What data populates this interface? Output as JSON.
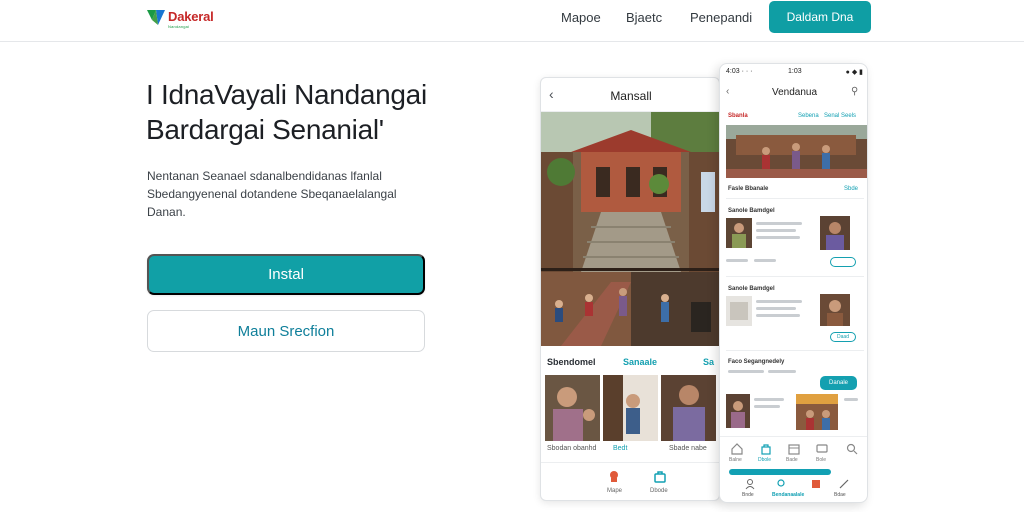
{
  "header": {
    "logo_text": "Dakeral",
    "logo_sub": "Nandangai",
    "nav": [
      "Mapoe",
      "Bjaetc",
      "Penepandi"
    ],
    "cta_label": "Daldam Dna"
  },
  "hero": {
    "title_lines": [
      "I IdnaVayali Nandangai",
      "Bardargai Senanial'"
    ],
    "desc_lines": [
      "Nentanan Seanael sdanalbendidanas lfanlal",
      "Sbedangyenenal dotandene Sbeqanaelalangal",
      "Danan."
    ],
    "primary_button": "Instal",
    "secondary_button": "Maun Srecfion"
  },
  "phone_back": {
    "title": "Mansall",
    "section_title": "Sbendomel",
    "section_link": "Sanaale",
    "section_link2": "Sa",
    "thumb_labels": [
      "Sbodan obanhd",
      "Bedt",
      "Sbade nabe"
    ],
    "tabs": [
      "Mape",
      "Dbode"
    ]
  },
  "phone_front": {
    "status_left": "4:03 · · ·",
    "status_center": "1:03",
    "status_right": "● ◆ ▮",
    "title": "Vendanua",
    "red_label": "Sbanla",
    "hero_links": [
      "Sebena",
      "Senal Seels"
    ],
    "section1": {
      "label": "Fasle Bbanale",
      "link": "Sbde"
    },
    "section2": {
      "label": "Sanole Bamdgel",
      "pill": "Daad"
    },
    "section3": {
      "label": "Sanale Bebanal",
      "pill": "Danal"
    },
    "section4": {
      "label": "Faco Segangnedely",
      "pill": "Danale"
    },
    "tabs": [
      "Balne",
      "Dbole",
      "Bade",
      "Bole"
    ],
    "bottom_labels": [
      "Bnde",
      "Bendanaalale",
      "Bdae"
    ]
  },
  "colors": {
    "accent": "#11a0a6",
    "brand_red": "#c62828",
    "brand_green": "#1a9a45",
    "text_dark": "#1c1f24"
  }
}
